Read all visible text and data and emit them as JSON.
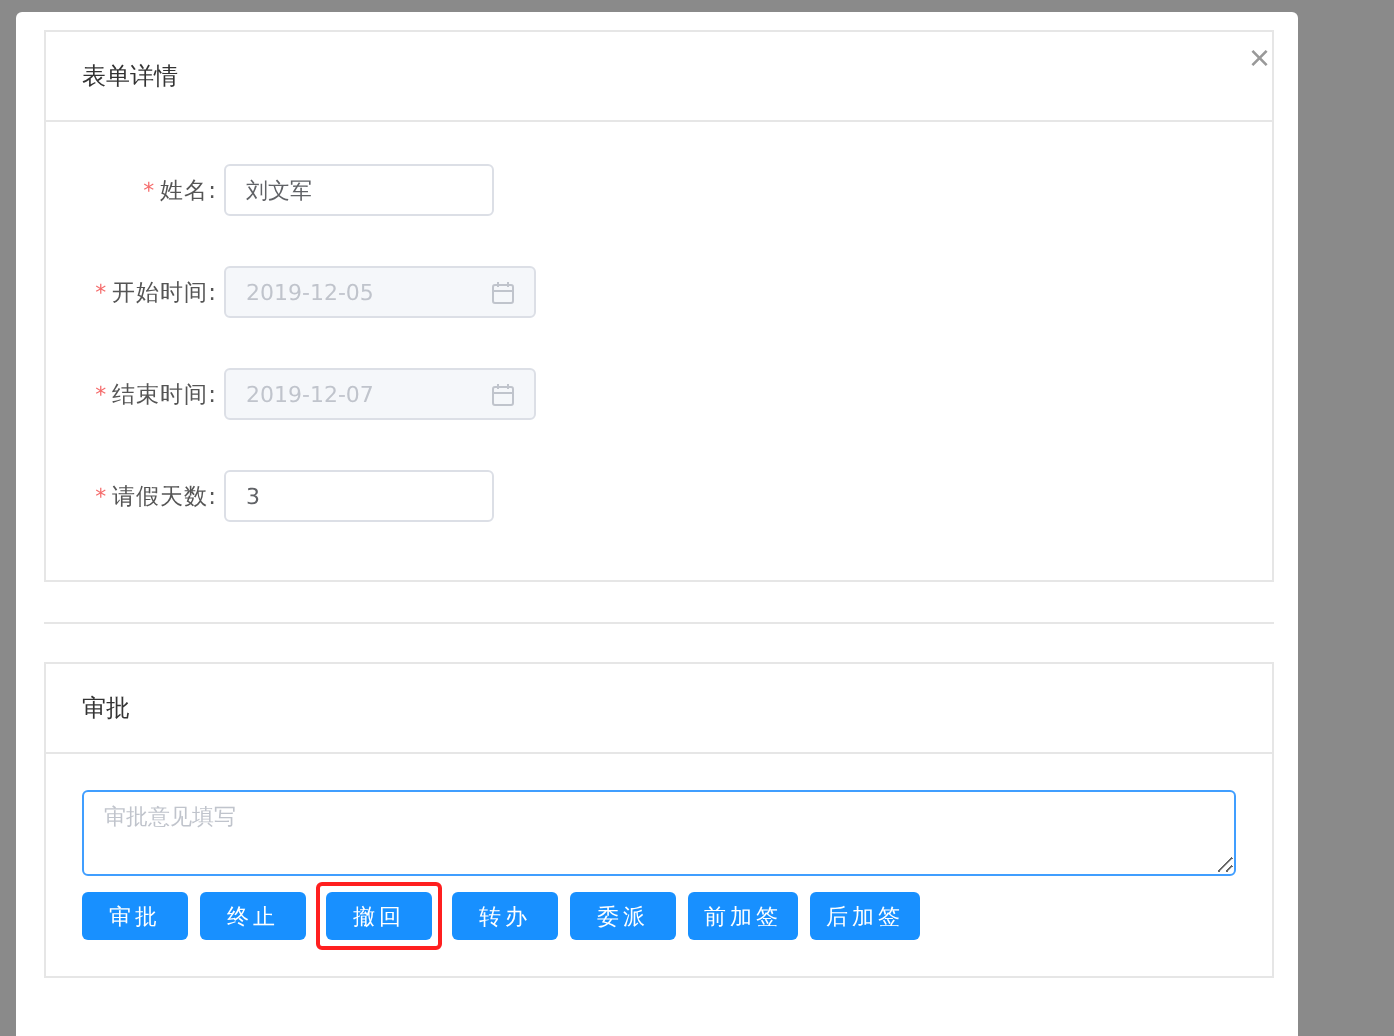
{
  "dialog": {
    "close": "×"
  },
  "form_card": {
    "title": "表单详情",
    "fields": [
      {
        "label": "姓名:",
        "required_mark": "*",
        "value": "刘文军",
        "kind": "text",
        "disabled": false
      },
      {
        "label": "开始时间:",
        "required_mark": "*",
        "value": "2019-12-05",
        "kind": "date",
        "disabled": true
      },
      {
        "label": "结束时间:",
        "required_mark": "*",
        "value": "2019-12-07",
        "kind": "date",
        "disabled": true
      },
      {
        "label": "请假天数:",
        "required_mark": "*",
        "value": "3",
        "kind": "text",
        "disabled": false
      }
    ]
  },
  "approval_card": {
    "title": "审批",
    "comment": {
      "placeholder": "审批意见填写"
    },
    "buttons": [
      {
        "label": "审批",
        "highlighted": false
      },
      {
        "label": "终止",
        "highlighted": false
      },
      {
        "label": "撤回",
        "highlighted": true
      },
      {
        "label": "转办",
        "highlighted": false
      },
      {
        "label": "委派",
        "highlighted": false
      },
      {
        "label": "前加签",
        "highlighted": false
      },
      {
        "label": "后加签",
        "highlighted": false
      }
    ]
  }
}
